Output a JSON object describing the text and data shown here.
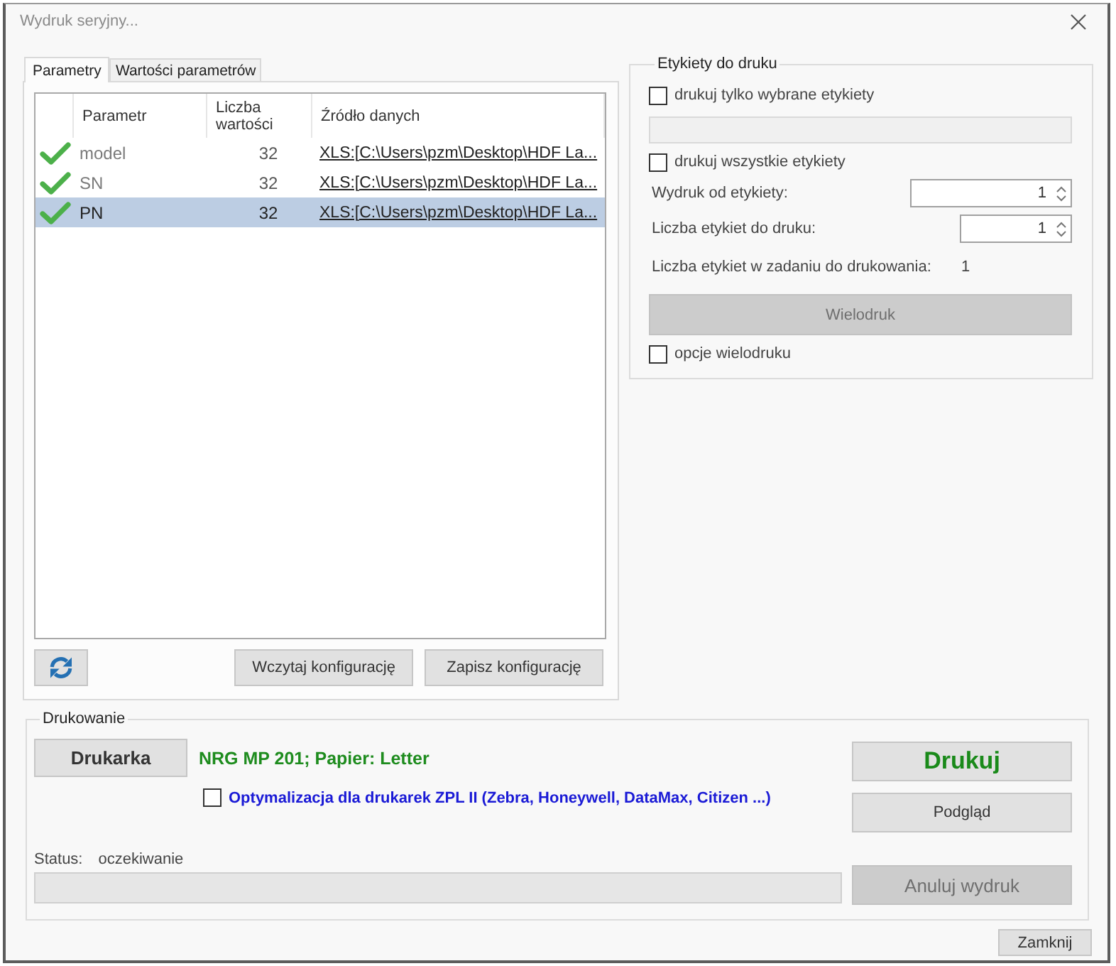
{
  "window": {
    "title": "Wydruk seryjny..."
  },
  "tabs": [
    {
      "label": "Parametry",
      "selected": true
    },
    {
      "label": "Wartości parametrów",
      "selected": false
    }
  ],
  "parameters_table": {
    "columns": [
      "Parametr",
      "Liczba wartości",
      "Źródło danych"
    ],
    "rows": [
      {
        "valid": true,
        "parameter": "model",
        "count": "32",
        "source": "XLS:[C:\\Users\\pzm\\Desktop\\HDF La...",
        "selected": false
      },
      {
        "valid": true,
        "parameter": "SN",
        "count": "32",
        "source": "XLS:[C:\\Users\\pzm\\Desktop\\HDF La...",
        "selected": false
      },
      {
        "valid": true,
        "parameter": "PN",
        "count": "32",
        "source": "XLS:[C:\\Users\\pzm\\Desktop\\HDF La...",
        "selected": true
      }
    ]
  },
  "config_buttons": [
    "Wczytaj konfigurację",
    "Zapisz konfigurację"
  ],
  "labels_to_print": {
    "title": "Etykiety do druku",
    "items": [
      {
        "kind": "checkbox",
        "label": "drukuj tylko wybrane etykiety",
        "checked": false
      },
      {
        "kind": "field",
        "disabled": true
      },
      {
        "kind": "checkbox",
        "label": "drukuj wszystkie etykiety",
        "checked": false
      },
      {
        "kind": "spin",
        "label": "Wydruk od etykiety:",
        "value": "1"
      },
      {
        "kind": "spin",
        "label": "Liczba etykiet do druku:",
        "value": "1"
      },
      {
        "kind": "info",
        "label": "Liczba etykiet w zadaniu do drukowania:",
        "value": "1"
      },
      {
        "kind": "button",
        "label": "Wielodruk",
        "disabled": true
      },
      {
        "kind": "checkbox",
        "label": "opcje wielodruku",
        "checked": false
      }
    ]
  },
  "printing": {
    "title": "Drukowanie",
    "printer_button": "Drukarka",
    "printer_info": "NRG MP 201; Papier: Letter",
    "zpl_optimization": {
      "label": "Optymalizacja dla drukarek ZPL II (Zebra, Honeywell, DataMax, Citizen ...)",
      "checked": false
    },
    "status_label": "Status:",
    "status_value": "oczekiwanie",
    "progress": {
      "level": 0
    },
    "actions": [
      {
        "kind": "print",
        "label": "Drukuj",
        "disabled": false
      },
      {
        "kind": "preview",
        "label": "Podgląd",
        "disabled": false
      },
      {
        "kind": "cancel",
        "label": "Anuluj wydruk",
        "disabled": true
      }
    ]
  },
  "close_button": "Zamknij"
}
